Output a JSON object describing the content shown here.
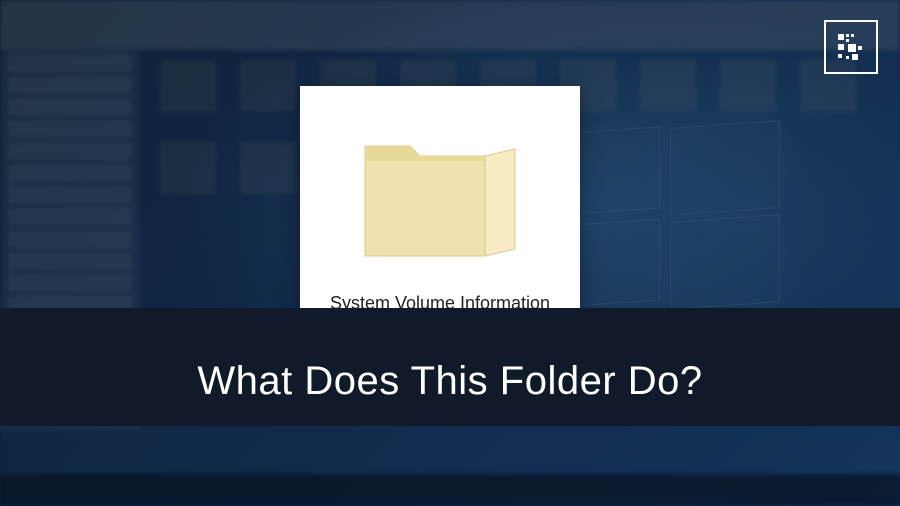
{
  "folder_card": {
    "label": "System Volume Information"
  },
  "headline": "What Does This Folder Do?",
  "colors": {
    "background_dark": "#0a2847",
    "background_light": "#1a5ba8",
    "band": "#101a28",
    "card_bg": "#ffffff",
    "folder_fill": "#f5e7b8",
    "folder_tab": "#e8d89a"
  },
  "brand": {
    "icon_name": "fossbytes-logo"
  }
}
